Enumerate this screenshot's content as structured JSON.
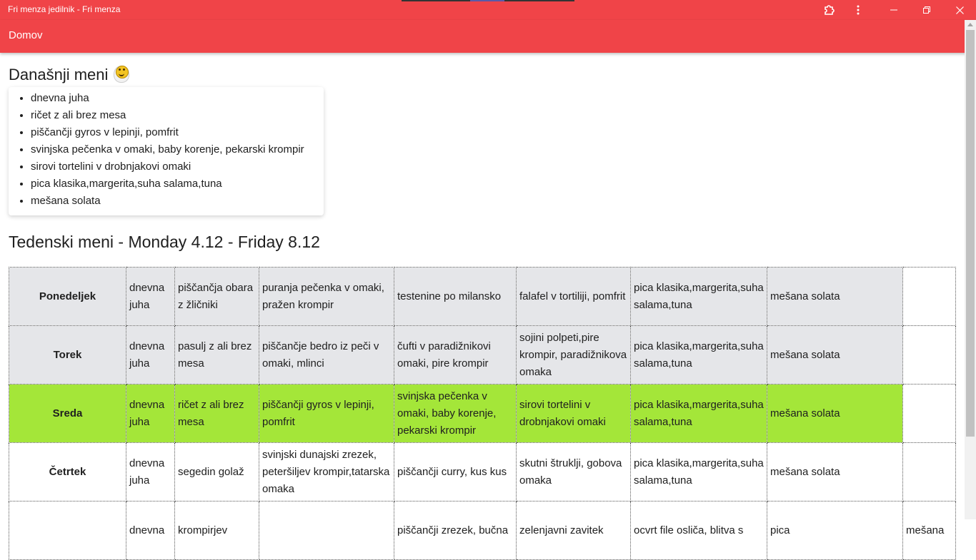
{
  "window": {
    "title": "Fri menza jedilnik - Fri menza",
    "buttons": [
      "extension-icon",
      "more-vert-icon",
      "minimize-icon",
      "restore-icon",
      "close-icon"
    ]
  },
  "header": {
    "nav_label": "Domov",
    "color": "#f04448"
  },
  "today": {
    "heading": "Današnji meni",
    "items": [
      "dnevna juha",
      "ričet z ali brez mesa",
      "piščančji gyros v lepinji, pomfrit",
      "svinjska pečenka v omaki, baby korenje, pekarski krompir",
      "sirovi tortelini v drobnjakovi omaki",
      "pica klasika,margerita,suha salama,tuna",
      "mešana solata"
    ]
  },
  "weekly": {
    "heading": "Tedenski meni - Monday 4.12 - Friday 8.12",
    "highlight_color": "#a4e639",
    "rows": [
      {
        "day": "Ponedeljek",
        "cells": [
          "dnevna juha",
          "piščančja obara z žličniki",
          "puranja pečenka v omaki, pražen krompir",
          "testenine po milansko",
          "falafel v tortiliji, pomfrit",
          "pica klasika,margerita,suha salama,tuna",
          "mešana solata",
          ""
        ]
      },
      {
        "day": "Torek",
        "cells": [
          "dnevna juha",
          "pasulj z ali brez mesa",
          "piščančje bedro iz peči v omaki, mlinci",
          "čufti v paradižnikovi omaki, pire krompir",
          "sojini polpeti,pire krompir, paradižnikova omaka",
          "pica klasika,margerita,suha salama,tuna",
          "mešana solata",
          ""
        ]
      },
      {
        "day": "Sreda",
        "cells": [
          "dnevna juha",
          "ričet z ali brez mesa",
          "piščančji gyros v lepinji, pomfrit",
          "svinjska pečenka v omaki, baby korenje, pekarski krompir",
          "sirovi tortelini v drobnjakovi omaki",
          "pica klasika,margerita,suha salama,tuna",
          "mešana solata",
          ""
        ]
      },
      {
        "day": "Četrtek",
        "cells": [
          "dnevna juha",
          "segedin golaž",
          "svinjski dunajski zrezek, peteršiljev krompir,tatarska omaka",
          "piščančji curry, kus kus",
          "skutni štruklji, gobova omaka",
          "pica klasika,margerita,suha salama,tuna",
          "mešana solata",
          ""
        ]
      },
      {
        "day": "",
        "cells": [
          "dnevna",
          "krompirjev",
          "",
          "piščančji zrezek, bučna",
          "zelenjavni zavitek",
          "ocvrt file osliča, blitva s",
          "pica",
          "mešana"
        ]
      }
    ]
  }
}
